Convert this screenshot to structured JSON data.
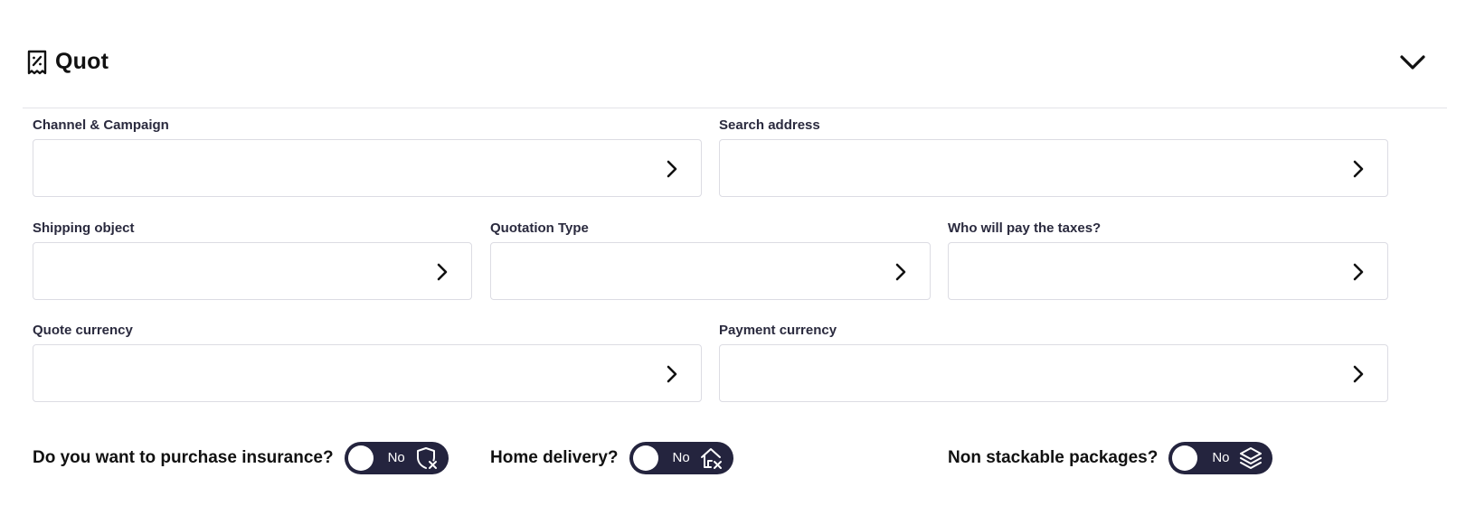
{
  "header": {
    "title": "Quot",
    "title_icon": "receipt-percent-icon",
    "collapse_icon": "chevron-down-icon"
  },
  "fields": {
    "channel_campaign": {
      "label": "Channel & Campaign",
      "value": ""
    },
    "search_address": {
      "label": "Search address",
      "value": ""
    },
    "shipping_object": {
      "label": "Shipping object",
      "value": ""
    },
    "quotation_type": {
      "label": "Quotation Type",
      "value": ""
    },
    "tax_payer": {
      "label": "Who will pay the taxes?",
      "value": ""
    },
    "quote_currency": {
      "label": "Quote currency",
      "value": ""
    },
    "payment_currency": {
      "label": "Payment currency",
      "value": ""
    }
  },
  "toggles": {
    "insurance": {
      "label": "Do you want to purchase insurance?",
      "state": "No",
      "icon": "shield-x-icon"
    },
    "home_delivery": {
      "label": "Home delivery?",
      "state": "No",
      "icon": "home-x-icon"
    },
    "non_stackable": {
      "label": "Non stackable packages?",
      "state": "No",
      "icon": "stack-layers-icon"
    }
  },
  "colors": {
    "toggle_bg": "#24243e",
    "border": "#dcdce3",
    "label": "#2a2a3e"
  }
}
